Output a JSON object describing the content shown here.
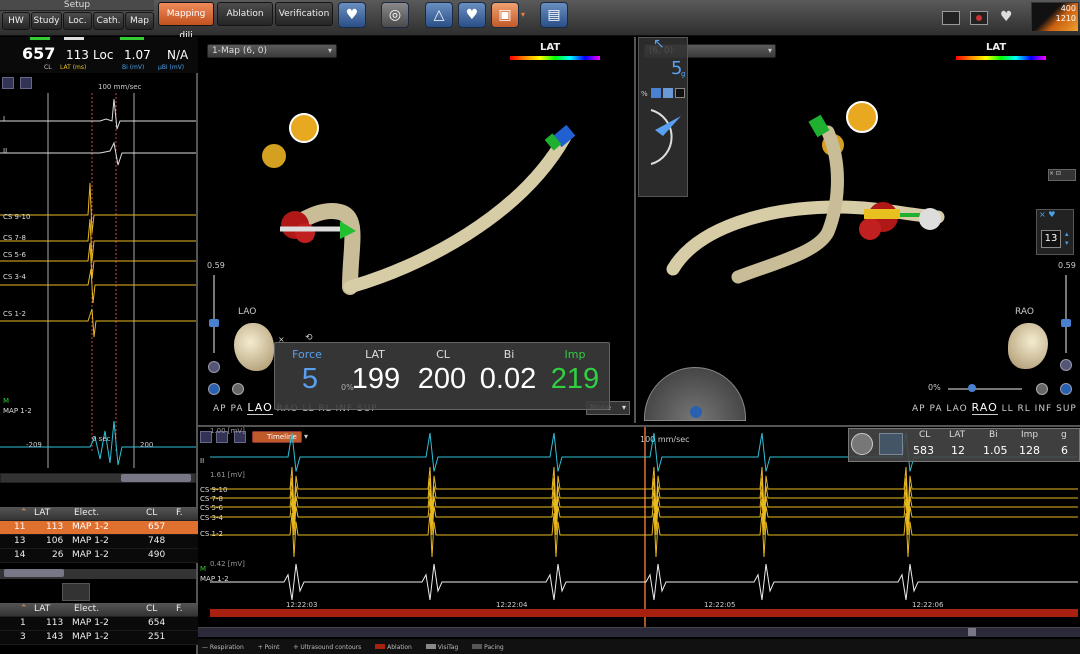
{
  "toolbar": {
    "setup_label": "Setup",
    "buttons": [
      "HW",
      "Study",
      "Loc.",
      "Cath.",
      "Map"
    ],
    "tabs": [
      "Mapping dili",
      "Ablation",
      "Verification"
    ],
    "counter_top": "400",
    "counter_bottom": "1210"
  },
  "left_panel": {
    "cl_value": "657",
    "cl_label": "CL",
    "lat_value": "113",
    "lat_label": "LAT (ms)",
    "loc_label": "Loc",
    "bi_value": "1.07",
    "bi_label": "Bi (mV)",
    "ubi_value": "N/A",
    "ubi_label": "µBi (mV)",
    "speed": "100 mm/sec",
    "channels": [
      "I",
      "II",
      "CS 9-10",
      "CS 7-8",
      "CS 5-6",
      "CS 3-4",
      "CS 1-2",
      "MAP 1-2"
    ],
    "marker_m": "M",
    "scale_left": "-209",
    "scale_zero": "0 sec",
    "scale_right": "200"
  },
  "table1": {
    "headers": [
      "LAT",
      "Elect.",
      "CL",
      "F."
    ],
    "rows": [
      {
        "id": "11",
        "lat": "113",
        "elect": "MAP 1-2",
        "cl": "657"
      },
      {
        "id": "13",
        "lat": "106",
        "elect": "MAP 1-2",
        "cl": "748"
      },
      {
        "id": "14",
        "lat": "26",
        "elect": "MAP 1-2",
        "cl": "490"
      }
    ]
  },
  "table2": {
    "headers": [
      "LAT",
      "Elect.",
      "CL",
      "F."
    ],
    "rows": [
      {
        "id": "1",
        "lat": "113",
        "elect": "MAP 1-2",
        "cl": "654"
      },
      {
        "id": "3",
        "lat": "143",
        "elect": "MAP 1-2",
        "cl": "251"
      }
    ]
  },
  "view_left": {
    "title": "1-Map (6, 0)",
    "lat_label": "LAT",
    "scale": "0.59",
    "orientation": "LAO",
    "views": [
      "AP",
      "PA",
      "LAO",
      "RAO",
      "LL",
      "RL",
      "INF",
      "SUP"
    ],
    "percent": "0%",
    "dropdown": "None"
  },
  "view_right": {
    "title": "(6, 0)",
    "lat_label": "LAT",
    "scale": "0.59",
    "orientation": "RAO",
    "views": [
      "AP",
      "PA",
      "LAO",
      "RAO",
      "LL",
      "RL",
      "INF",
      "SUP"
    ],
    "percent": "0%",
    "force_small": "5",
    "force_unit": "g",
    "spinner": "13",
    "pct_label": "%"
  },
  "metrics": {
    "labels": [
      "Force",
      "LAT",
      "CL",
      "Bi",
      "Imp"
    ],
    "values": [
      "5",
      "199",
      "200",
      "0.02",
      "219"
    ]
  },
  "bottom": {
    "timeline_label": "Timeline",
    "speed": "100 mm/sec",
    "mv_top": "1.00 [mV]",
    "lead": "II",
    "mv_cs": "1.61 [mV]",
    "cs_channels": [
      "CS 9-10",
      "CS 7-8",
      "CS 5-6",
      "CS 3-4",
      "CS 1-2"
    ],
    "mv_map": "0.42 [mV]",
    "map_channel": "MAP 1-2",
    "marker_m": "M",
    "times": [
      "12:22:03",
      "12:22:04",
      "12:22:05",
      "12:22:06"
    ],
    "legend": [
      "Respiration",
      "Point",
      "Ultrasound contours",
      "Ablation",
      "VisiTag",
      "Pacing"
    ],
    "mini_labels": [
      "CL",
      "LAT",
      "Bi",
      "Imp",
      "g"
    ],
    "mini_values": [
      "583",
      "12",
      "1.05",
      "128",
      "6"
    ]
  },
  "colors": {
    "accent": "#e07030",
    "force_blue": "#5aa0f0",
    "imp_green": "#30d040",
    "ecg_yellow": "#e8b820",
    "ecg_cyan": "#30c0d8"
  }
}
